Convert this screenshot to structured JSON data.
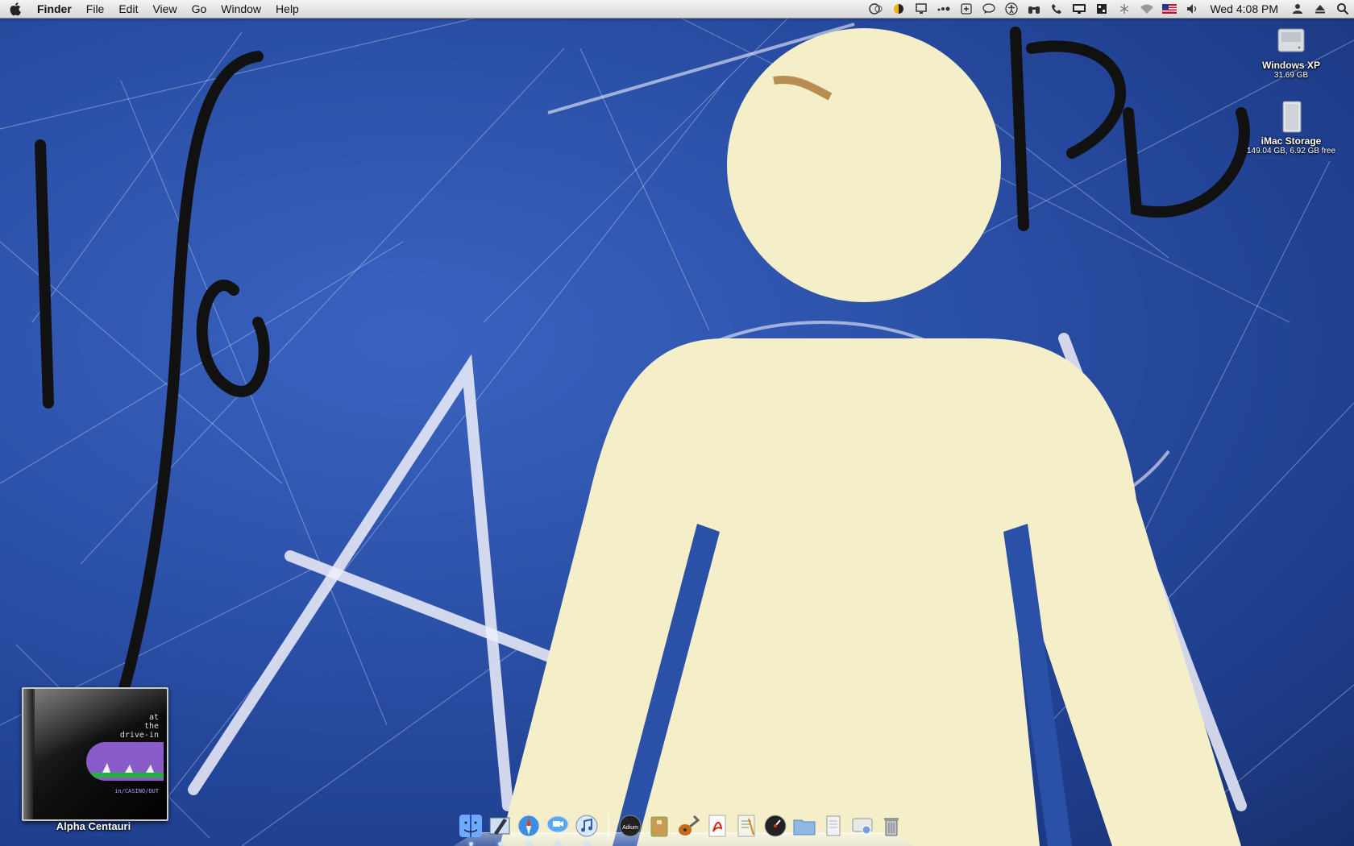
{
  "menubar": {
    "apple_icon": "apple-icon",
    "app_name": "Finder",
    "menus": [
      "File",
      "Edit",
      "View",
      "Go",
      "Window",
      "Help"
    ],
    "status_icons": [
      "time-machine-icon",
      "weather-icon",
      "monitor-icon",
      "dots-icon",
      "plus-box-icon",
      "chat-bubble-icon",
      "accessibility-icon",
      "binoculars-icon",
      "phone-icon",
      "display-icon",
      "spaces-icon",
      "bluetooth-icon",
      "wifi-icon",
      "flag-icon",
      "volume-icon"
    ],
    "clock": "Wed 4:08 PM",
    "user_icon": "user-icon",
    "eject_icon": "eject-icon",
    "spotlight_icon": "spotlight-search-icon"
  },
  "desktop": {
    "drives": [
      {
        "name": "Windows XP",
        "info": "31.69 GB"
      },
      {
        "name": "iMac Storage",
        "info": "149.04 GB, 6.92 GB free"
      }
    ]
  },
  "cd_widget": {
    "cover_text": [
      "at",
      "the",
      "drive-in"
    ],
    "cover_subtext": "in/CASINO/OUT",
    "title": "Alpha Centauri"
  },
  "dock": {
    "apps": [
      "finder-icon",
      "mail-icon",
      "safari-icon",
      "ichat-icon",
      "itunes-icon"
    ],
    "others": [
      "adium-icon",
      "package-icon",
      "guitar-icon",
      "pdf-icon",
      "text-edit-icon",
      "dashboard-icon",
      "folder-icon",
      "document-icon",
      "network-icon",
      "trash-icon"
    ],
    "adium_label": "Adium"
  },
  "colors": {
    "wallpaper_blue": "#2b50a8",
    "figure_cream": "#f4efc8"
  }
}
